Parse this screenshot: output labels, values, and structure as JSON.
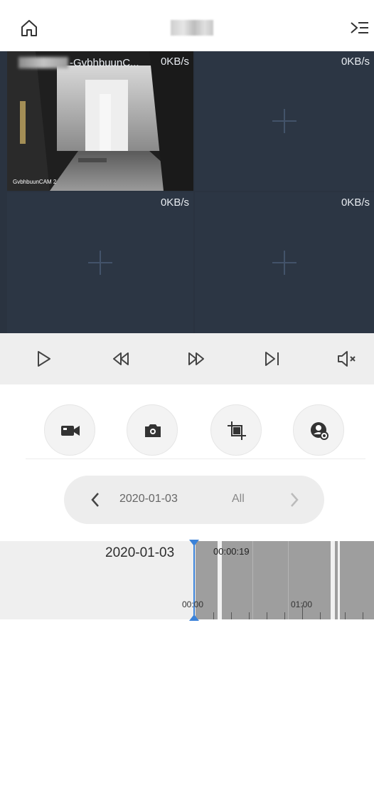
{
  "header": {
    "title": ""
  },
  "video": {
    "tiles": [
      {
        "rate": "0KB/s",
        "name": "-GvbhbuunC...",
        "label": "GvbhbuunCAM 2"
      },
      {
        "rate": "0KB/s"
      },
      {
        "rate": "0KB/s"
      },
      {
        "rate": "0KB/s"
      }
    ]
  },
  "playback": {
    "controls": [
      "play-icon",
      "rewind-icon",
      "fast-forward-icon",
      "next-frame-icon",
      "mute-icon"
    ]
  },
  "tools": [
    "record-icon",
    "snapshot-icon",
    "crop-icon",
    "face-detect-icon"
  ],
  "date_selector": {
    "date": "2020-01-03",
    "filter": "All"
  },
  "timeline": {
    "date": "2020-01-03",
    "current_time": "00:00:19",
    "ticks": [
      "00:00",
      "01:00"
    ]
  },
  "colors": {
    "accent": "#3b82d8",
    "grid_bg": "#2c3644"
  }
}
